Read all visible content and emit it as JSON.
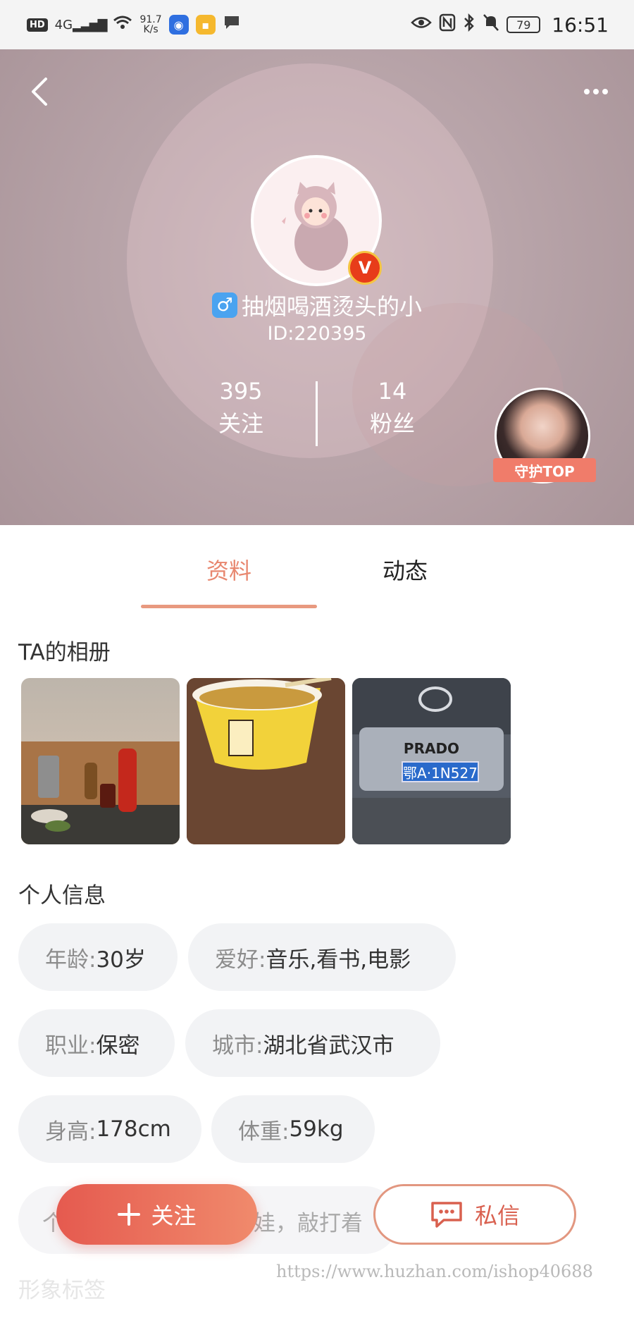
{
  "status_bar": {
    "left_badge": "HD",
    "network": "4G",
    "speed_value": "91.7",
    "speed_unit": "K/s",
    "battery": "79",
    "time": "16:51"
  },
  "profile": {
    "nickname": "抽烟喝酒烫头的小",
    "gender_symbol": "♂",
    "user_id": "ID:220395",
    "vip_badge": "V",
    "following_count": "395",
    "following_label": "关注",
    "fans_count": "14",
    "fans_label": "粉丝",
    "guard_label": "守护TOP"
  },
  "tabs": [
    {
      "label": "资料",
      "active": true
    },
    {
      "label": "动态",
      "active": false
    }
  ],
  "album": {
    "title": "TA的相册",
    "photo3_plate": "鄂A·1N527",
    "photo3_brand": "PRADO"
  },
  "personal_info": {
    "title": "个人信息",
    "tags": [
      {
        "key": "年龄:",
        "value": "30岁"
      },
      {
        "key": "爱好:",
        "value": "音乐,看书,电影"
      },
      {
        "key": "职业:",
        "value": "保密"
      },
      {
        "key": "城市:",
        "value": "湖北省武汉市"
      },
      {
        "key": "身高:",
        "value": "178cm"
      },
      {
        "key": "体重:",
        "value": "59kg"
      }
    ],
    "partial_row_left": "个",
    "partial_row_mid": "娃，敲打着"
  },
  "next_section_title": "形象标签",
  "actions": {
    "follow_label": "关注",
    "message_label": "私信"
  },
  "watermark": "https://www.huzhan.com/ishop40688",
  "colors": {
    "accent": "#e8876f",
    "follow_gradient_start": "#e55a4f",
    "follow_gradient_end": "#f08a6c",
    "tag_bg": "#f2f3f5"
  }
}
